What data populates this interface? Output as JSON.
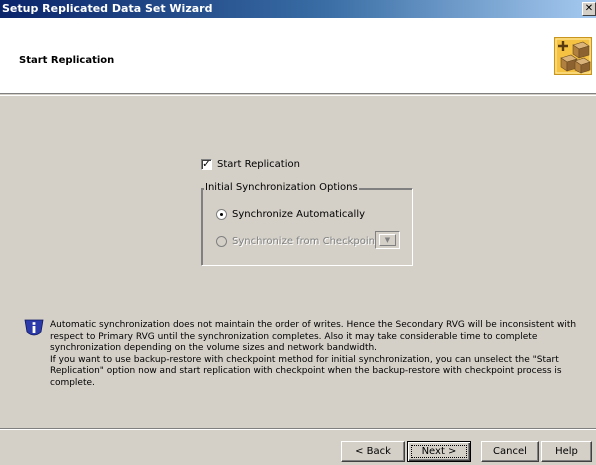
{
  "window": {
    "title": "Setup Replicated Data Set Wizard",
    "close_symbol": "✕"
  },
  "header": {
    "heading": "Start Replication",
    "icon": "wizard-boxes-icon"
  },
  "start_replication": {
    "label": "Start Replication",
    "checked": true
  },
  "sync_options": {
    "legend": "Initial Synchronization Options",
    "options": [
      {
        "label": "Synchronize Automatically",
        "selected": true,
        "enabled": true
      },
      {
        "label": "Synchronize from Checkpoint",
        "selected": false,
        "enabled": false
      }
    ],
    "checkpoint_select_value": ""
  },
  "info": {
    "icon": "info-icon",
    "text": "Automatic synchronization does not maintain the order of writes. Hence the Secondary RVG will be inconsistent with respect to Primary RVG until the synchronization completes. Also it may take considerable time to complete synchronization depending on the volume sizes and network bandwidth.\nIf you want to use backup-restore with checkpoint method for initial synchronization, you can unselect the \"Start Replication\" option now and start replication with checkpoint when the backup-restore with checkpoint process is complete."
  },
  "buttons": {
    "back": "< Back",
    "next": "Next >",
    "cancel": "Cancel",
    "help": "Help"
  },
  "colors": {
    "dialog_bg": "#d4d0c8",
    "title_gradient_start": "#0a246a",
    "info_icon_blue": "#2b3aa8",
    "wizard_icon_bg": "#f5c242"
  }
}
